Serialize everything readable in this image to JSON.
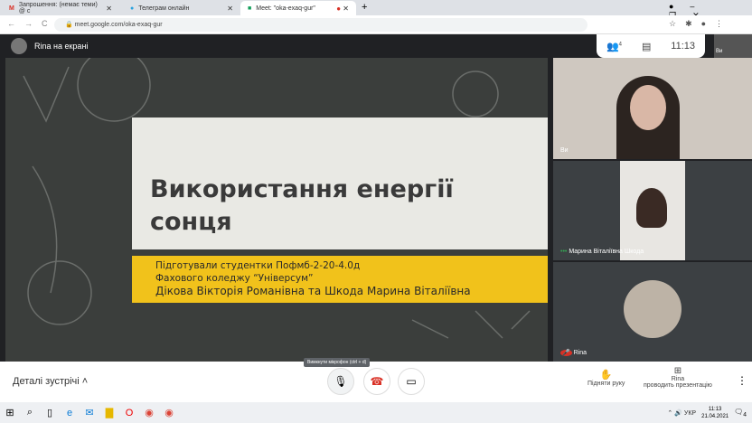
{
  "browser": {
    "tabs": [
      {
        "label": "Запрошення: (немає теми) @ с",
        "icon": "gmail-icon",
        "active": false
      },
      {
        "label": "Телеграм онлайн",
        "icon": "telegram-icon",
        "active": false
      },
      {
        "label": "Meet: \"oka-exaq-gur\"",
        "icon": "meet-icon",
        "active": true
      }
    ],
    "url": "meet.google.com/oka-exaq-gur"
  },
  "meet": {
    "presenter_label": "Rina на екрані",
    "time": "11:13",
    "participants_count": "4",
    "slide": {
      "title_line1": "Використання енергії",
      "title_line2": "сонця",
      "subtitle1": "Підготували студентки Пофмб-2-20-4.0д",
      "subtitle2": "Фахового коледжу “Універсум”",
      "subtitle3": "Дікова Вікторія Романівна та Шкода Марина Віталіївна"
    },
    "tiles": [
      {
        "name": "Ви"
      },
      {
        "name": "Марина Віталіївна Шкода"
      },
      {
        "name": "Rina"
      }
    ],
    "self_thumb": "Ви",
    "bottom": {
      "details": "Деталі зустрічі",
      "tooltip": "Вимкнути мікрофон (ctrl + d)",
      "raise_hand": "Підняти руку",
      "presenter": "Rina",
      "presenting": "проводить презентацію"
    }
  },
  "taskbar": {
    "lang": "УКР",
    "time": "11:13",
    "date": "21.04.2021",
    "notifications": "4"
  }
}
